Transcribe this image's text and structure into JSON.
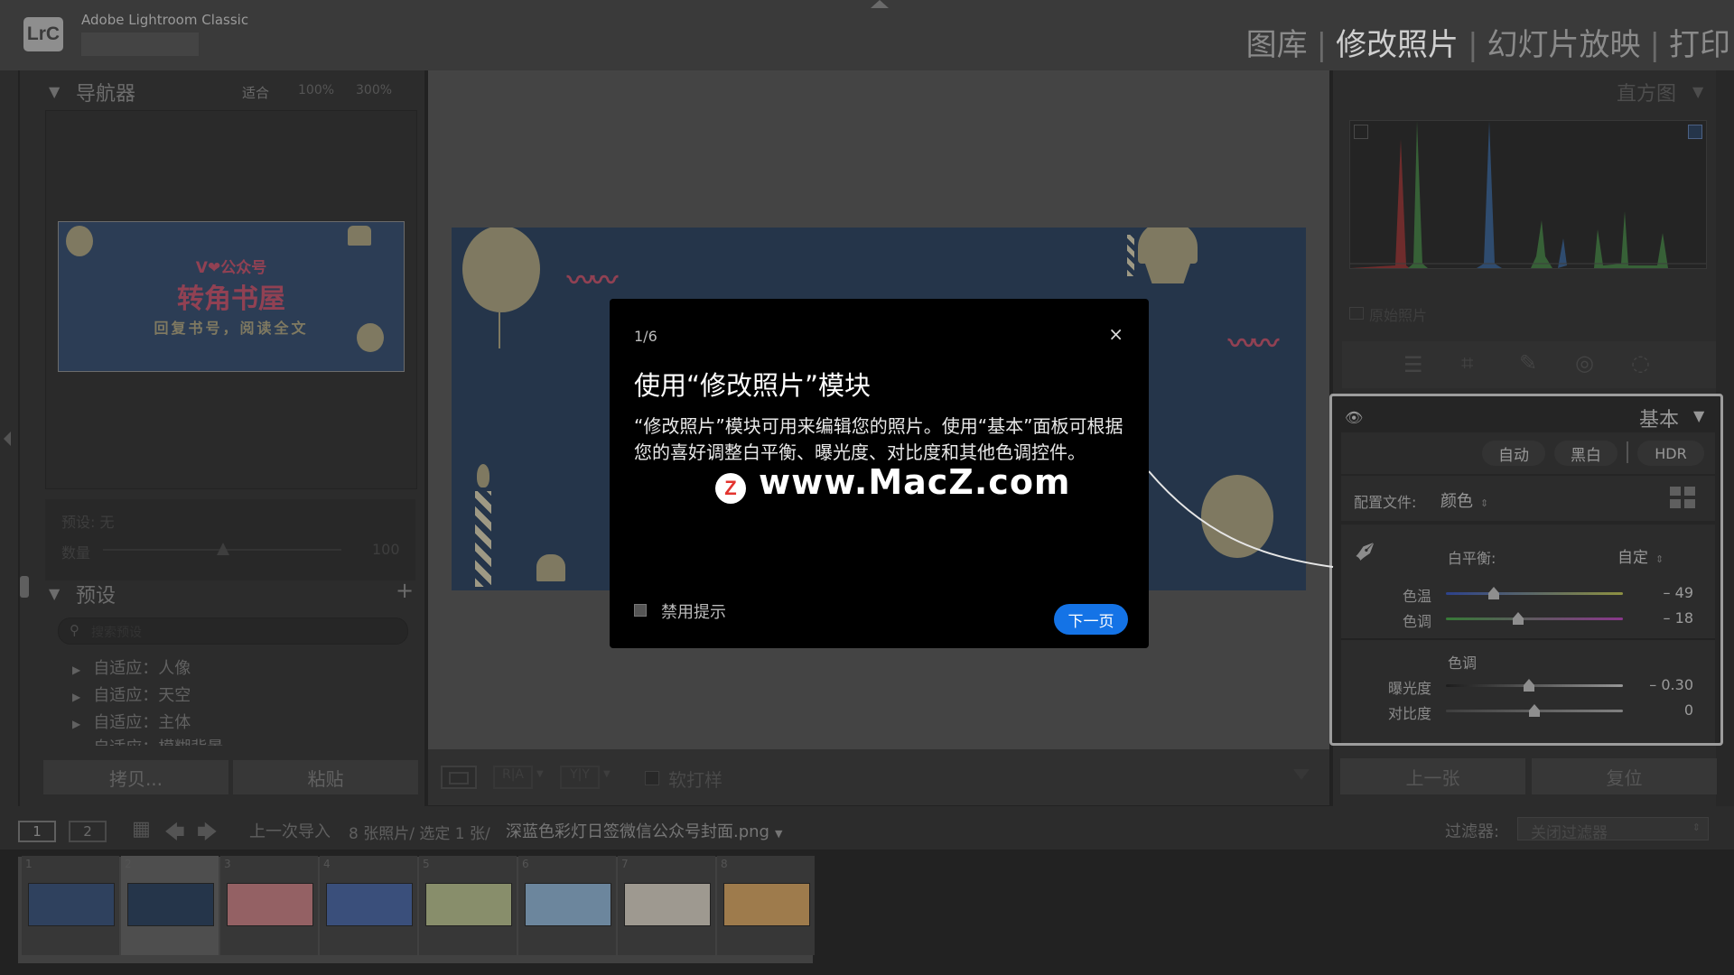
{
  "app": {
    "logo": "LrC",
    "title": "Adobe Lightroom Classic"
  },
  "modules": [
    {
      "label": "图库",
      "active": false
    },
    {
      "label": "修改照片",
      "active": true
    },
    {
      "label": "幻灯片放映",
      "active": false
    },
    {
      "label": "打印",
      "active": false
    }
  ],
  "left_panel": {
    "navigator": {
      "title": "导航器",
      "zoom_fit": "适合",
      "zoom_100": "100%",
      "zoom_300": "300%"
    },
    "preset_amount": {
      "preset_label": "预设: 无",
      "amount_label": "数量",
      "amount_value": "100"
    },
    "presets": {
      "title": "预设",
      "add": "+",
      "search_placeholder": "搜索预设",
      "items": [
        "自适应：人像",
        "自适应：天空",
        "自适应：主体",
        "自适应：模糊背景"
      ]
    },
    "copy_button": "拷贝...",
    "paste_button": "粘贴"
  },
  "thumbnail_text": {
    "line1": "V❤公众号",
    "line2": "转角书屋",
    "line3": "回复书号，阅读全文"
  },
  "center_toolbar": {
    "soft_proof": "软打样"
  },
  "right_panel": {
    "histogram": {
      "title": "直方图",
      "original_photo": "原始照片"
    },
    "basic": {
      "title": "基本",
      "auto": "自动",
      "bw": "黑白",
      "hdr": "HDR",
      "profile_label": "配置文件:",
      "profile_value": "颜色",
      "wb_label": "白平衡:",
      "wb_value": "自定",
      "temp_label": "色温",
      "temp_value": "– 49",
      "temp_level": 0.27,
      "tint_label": "色调",
      "tint_value": "– 18",
      "tint_level": 0.41,
      "tone_title": "色调",
      "exposure_label": "曝光度",
      "exposure_value": "– 0.30",
      "exposure_level": 0.47,
      "contrast_label": "对比度",
      "contrast_value": "0",
      "contrast_level": 0.5
    },
    "prev_button": "上一张",
    "reset_button": "复位"
  },
  "filmstrip_bar": {
    "page1": "1",
    "page2": "2",
    "source": "上一次导入",
    "count": "8 张照片/ 选定 1 张/",
    "filename": "深蓝色彩灯日签微信公众号封面.png",
    "filter_label": "过滤器:",
    "filter_value": "关闭过滤器"
  },
  "filmstrip": {
    "cells": [
      {
        "num": "1",
        "color": "#3e5a86"
      },
      {
        "num": "2",
        "color": "#2f4868"
      },
      {
        "num": "3",
        "color": "#d98a8f"
      },
      {
        "num": "4",
        "color": "#4f6fb3"
      },
      {
        "num": "5",
        "color": "#c7cf9a"
      },
      {
        "num": "6",
        "color": "#9bc3e6"
      },
      {
        "num": "7",
        "color": "#e8e1d3"
      },
      {
        "num": "8",
        "color": "#e9b36a"
      }
    ]
  },
  "dialog": {
    "counter": "1/6",
    "close": "×",
    "title": "使用“修改照片”模块",
    "body": "“修改照片”模块可用来编辑您的照片。使用“基本”面板可根据您的喜好调整白平衡、曝光度、对比度和其他色调控件。",
    "disable_tips": "禁用提示",
    "next_button": "下一页"
  },
  "watermark": {
    "logo": "Z",
    "text": "www.MacZ.com"
  },
  "colors": {
    "accent": "#1473e6",
    "photo_bg": "#2f4868",
    "balloon": "#b8b08a",
    "wave": "#d45a76"
  }
}
